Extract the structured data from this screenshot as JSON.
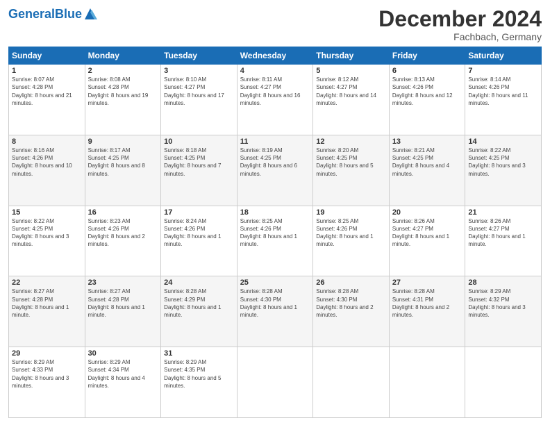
{
  "header": {
    "logo_general": "General",
    "logo_blue": "Blue",
    "month_title": "December 2024",
    "location": "Fachbach, Germany"
  },
  "days_of_week": [
    "Sunday",
    "Monday",
    "Tuesday",
    "Wednesday",
    "Thursday",
    "Friday",
    "Saturday"
  ],
  "weeks": [
    [
      {
        "day": "1",
        "sunrise": "8:07 AM",
        "sunset": "4:28 PM",
        "daylight": "8 hours and 21 minutes."
      },
      {
        "day": "2",
        "sunrise": "8:08 AM",
        "sunset": "4:28 PM",
        "daylight": "8 hours and 19 minutes."
      },
      {
        "day": "3",
        "sunrise": "8:10 AM",
        "sunset": "4:27 PM",
        "daylight": "8 hours and 17 minutes."
      },
      {
        "day": "4",
        "sunrise": "8:11 AM",
        "sunset": "4:27 PM",
        "daylight": "8 hours and 16 minutes."
      },
      {
        "day": "5",
        "sunrise": "8:12 AM",
        "sunset": "4:27 PM",
        "daylight": "8 hours and 14 minutes."
      },
      {
        "day": "6",
        "sunrise": "8:13 AM",
        "sunset": "4:26 PM",
        "daylight": "8 hours and 12 minutes."
      },
      {
        "day": "7",
        "sunrise": "8:14 AM",
        "sunset": "4:26 PM",
        "daylight": "8 hours and 11 minutes."
      }
    ],
    [
      {
        "day": "8",
        "sunrise": "8:16 AM",
        "sunset": "4:26 PM",
        "daylight": "8 hours and 10 minutes."
      },
      {
        "day": "9",
        "sunrise": "8:17 AM",
        "sunset": "4:25 PM",
        "daylight": "8 hours and 8 minutes."
      },
      {
        "day": "10",
        "sunrise": "8:18 AM",
        "sunset": "4:25 PM",
        "daylight": "8 hours and 7 minutes."
      },
      {
        "day": "11",
        "sunrise": "8:19 AM",
        "sunset": "4:25 PM",
        "daylight": "8 hours and 6 minutes."
      },
      {
        "day": "12",
        "sunrise": "8:20 AM",
        "sunset": "4:25 PM",
        "daylight": "8 hours and 5 minutes."
      },
      {
        "day": "13",
        "sunrise": "8:21 AM",
        "sunset": "4:25 PM",
        "daylight": "8 hours and 4 minutes."
      },
      {
        "day": "14",
        "sunrise": "8:22 AM",
        "sunset": "4:25 PM",
        "daylight": "8 hours and 3 minutes."
      }
    ],
    [
      {
        "day": "15",
        "sunrise": "8:22 AM",
        "sunset": "4:25 PM",
        "daylight": "8 hours and 3 minutes."
      },
      {
        "day": "16",
        "sunrise": "8:23 AM",
        "sunset": "4:26 PM",
        "daylight": "8 hours and 2 minutes."
      },
      {
        "day": "17",
        "sunrise": "8:24 AM",
        "sunset": "4:26 PM",
        "daylight": "8 hours and 1 minute."
      },
      {
        "day": "18",
        "sunrise": "8:25 AM",
        "sunset": "4:26 PM",
        "daylight": "8 hours and 1 minute."
      },
      {
        "day": "19",
        "sunrise": "8:25 AM",
        "sunset": "4:26 PM",
        "daylight": "8 hours and 1 minute."
      },
      {
        "day": "20",
        "sunrise": "8:26 AM",
        "sunset": "4:27 PM",
        "daylight": "8 hours and 1 minute."
      },
      {
        "day": "21",
        "sunrise": "8:26 AM",
        "sunset": "4:27 PM",
        "daylight": "8 hours and 1 minute."
      }
    ],
    [
      {
        "day": "22",
        "sunrise": "8:27 AM",
        "sunset": "4:28 PM",
        "daylight": "8 hours and 1 minute."
      },
      {
        "day": "23",
        "sunrise": "8:27 AM",
        "sunset": "4:28 PM",
        "daylight": "8 hours and 1 minute."
      },
      {
        "day": "24",
        "sunrise": "8:28 AM",
        "sunset": "4:29 PM",
        "daylight": "8 hours and 1 minute."
      },
      {
        "day": "25",
        "sunrise": "8:28 AM",
        "sunset": "4:30 PM",
        "daylight": "8 hours and 1 minute."
      },
      {
        "day": "26",
        "sunrise": "8:28 AM",
        "sunset": "4:30 PM",
        "daylight": "8 hours and 2 minutes."
      },
      {
        "day": "27",
        "sunrise": "8:28 AM",
        "sunset": "4:31 PM",
        "daylight": "8 hours and 2 minutes."
      },
      {
        "day": "28",
        "sunrise": "8:29 AM",
        "sunset": "4:32 PM",
        "daylight": "8 hours and 3 minutes."
      }
    ],
    [
      {
        "day": "29",
        "sunrise": "8:29 AM",
        "sunset": "4:33 PM",
        "daylight": "8 hours and 3 minutes."
      },
      {
        "day": "30",
        "sunrise": "8:29 AM",
        "sunset": "4:34 PM",
        "daylight": "8 hours and 4 minutes."
      },
      {
        "day": "31",
        "sunrise": "8:29 AM",
        "sunset": "4:35 PM",
        "daylight": "8 hours and 5 minutes."
      },
      null,
      null,
      null,
      null
    ]
  ]
}
